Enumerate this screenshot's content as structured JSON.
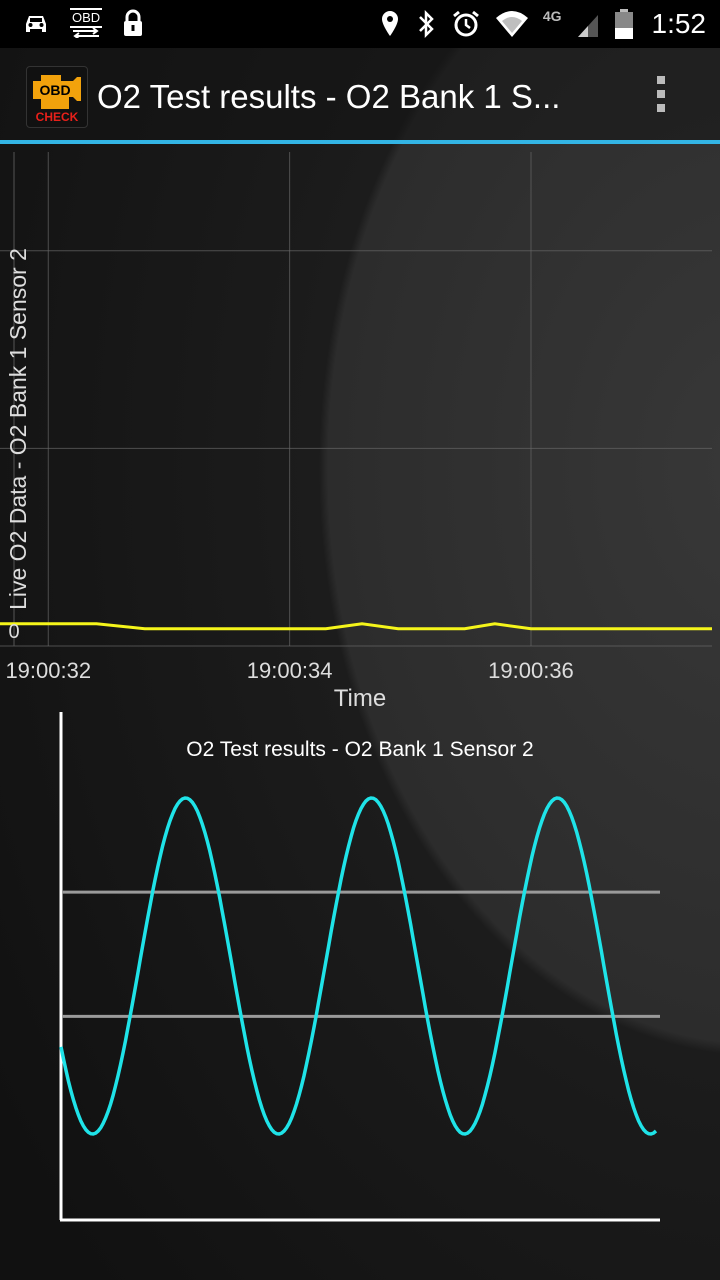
{
  "status_bar": {
    "left_icons": [
      "car-icon",
      "obd-icon",
      "lock-icon"
    ],
    "obd_label": "OBD",
    "right_icons": [
      "location-icon",
      "bluetooth-icon",
      "alarm-icon",
      "wifi-icon",
      "signal-icon",
      "battery-icon"
    ],
    "network_label": "4G",
    "time": "1:52"
  },
  "action_bar": {
    "app_icon": "obd-check-app-icon",
    "app_icon_text_top": "OBD",
    "app_icon_text_bottom": "CHECK",
    "title": "O2 Test results - O2 Bank 1 S...",
    "overflow_icon": "overflow-menu-icon"
  },
  "chart_data": [
    {
      "type": "line",
      "ylabel": "Live O2 Data - O2 Bank 1 Sensor 2",
      "xlabel": "Time",
      "x_ticks": [
        "19:00:32",
        "19:00:34",
        "19:00:36"
      ],
      "y_tick": "0",
      "grid": true,
      "series": [
        {
          "color": "#f5f51a",
          "x": [
            31.6,
            32.0,
            32.4,
            32.8,
            33.2,
            33.6,
            34.0,
            34.3,
            34.6,
            34.9,
            35.2,
            35.45,
            35.7,
            36.0,
            36.4,
            36.8,
            37.2,
            37.5
          ],
          "y": [
            0.045,
            0.045,
            0.045,
            0.035,
            0.035,
            0.035,
            0.035,
            0.035,
            0.045,
            0.035,
            0.035,
            0.035,
            0.045,
            0.035,
            0.035,
            0.035,
            0.035,
            0.035
          ]
        }
      ],
      "xlim": [
        31.6,
        37.5
      ],
      "ylim": [
        0,
        1
      ]
    },
    {
      "type": "line",
      "title": "O2 Test results - O2 Bank 1 Sensor 2",
      "line_color": "#1fe3e8",
      "threshold_color": "#9a9a9a",
      "thresholds": [
        0.35,
        0.72
      ],
      "cycles": 3.2,
      "ylim": [
        0,
        1
      ],
      "grid": false
    }
  ]
}
